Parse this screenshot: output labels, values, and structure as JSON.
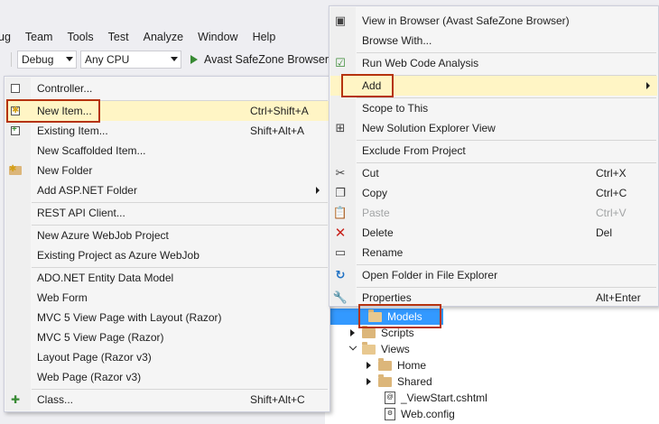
{
  "menubar": [
    "ug",
    "Team",
    "Tools",
    "Test",
    "Analyze",
    "Window",
    "Help"
  ],
  "toolbar": {
    "config": "Debug",
    "platform": "Any CPU",
    "run_label": "Avast SafeZone Browser"
  },
  "add_menu": {
    "items": [
      {
        "label": "Controller...",
        "shortcut": "",
        "icon": "controller-icon"
      },
      {
        "label": "New Item...",
        "shortcut": "Ctrl+Shift+A",
        "icon": "new-item-icon"
      },
      {
        "label": "Existing Item...",
        "shortcut": "Shift+Alt+A",
        "icon": "existing-item-icon"
      },
      {
        "label": "New Scaffolded Item...",
        "shortcut": "",
        "icon": ""
      },
      {
        "label": "New Folder",
        "shortcut": "",
        "icon": "new-folder-icon"
      },
      {
        "label": "Add ASP.NET Folder",
        "shortcut": "",
        "icon": ""
      },
      {
        "label": "REST API Client...",
        "shortcut": "",
        "icon": ""
      },
      {
        "label": "New Azure WebJob Project",
        "shortcut": "",
        "icon": ""
      },
      {
        "label": "Existing Project as Azure WebJob",
        "shortcut": "",
        "icon": ""
      },
      {
        "label": "ADO.NET Entity Data Model",
        "shortcut": "",
        "icon": ""
      },
      {
        "label": "Web Form",
        "shortcut": "",
        "icon": ""
      },
      {
        "label": "MVC 5 View Page with Layout (Razor)",
        "shortcut": "",
        "icon": ""
      },
      {
        "label": "MVC 5 View Page (Razor)",
        "shortcut": "",
        "icon": ""
      },
      {
        "label": "Layout Page (Razor v3)",
        "shortcut": "",
        "icon": ""
      },
      {
        "label": "Web Page (Razor v3)",
        "shortcut": "",
        "icon": ""
      },
      {
        "label": "Class...",
        "shortcut": "Shift+Alt+C",
        "icon": "class-icon"
      }
    ]
  },
  "context_menu": {
    "items": [
      {
        "label": "View in Browser (Avast SafeZone Browser)",
        "shortcut": ""
      },
      {
        "label": "Browse With...",
        "shortcut": ""
      },
      {
        "label": "Run Web Code Analysis",
        "shortcut": ""
      },
      {
        "label": "Add",
        "shortcut": ""
      },
      {
        "label": "Scope to This",
        "shortcut": ""
      },
      {
        "label": "New Solution Explorer View",
        "shortcut": ""
      },
      {
        "label": "Exclude From Project",
        "shortcut": ""
      },
      {
        "label": "Cut",
        "shortcut": "Ctrl+X"
      },
      {
        "label": "Copy",
        "shortcut": "Ctrl+C"
      },
      {
        "label": "Paste",
        "shortcut": "Ctrl+V"
      },
      {
        "label": "Delete",
        "shortcut": "Del"
      },
      {
        "label": "Rename",
        "shortcut": ""
      },
      {
        "label": "Open Folder in File Explorer",
        "shortcut": ""
      },
      {
        "label": "Properties",
        "shortcut": "Alt+Enter"
      }
    ]
  },
  "solution_tree": [
    {
      "label": "Models"
    },
    {
      "label": "Scripts"
    },
    {
      "label": "Views"
    },
    {
      "label": "Home"
    },
    {
      "label": "Shared"
    },
    {
      "label": "_ViewStart.cshtml"
    },
    {
      "label": "Web.config"
    }
  ],
  "colors": {
    "highlight": "#fff5c5",
    "callout": "#b5330f",
    "selection": "#3399ff"
  }
}
